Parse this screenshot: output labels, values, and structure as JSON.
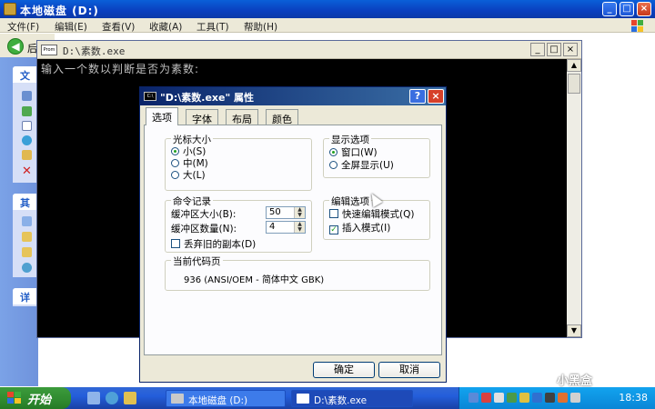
{
  "explorer": {
    "title": "本地磁盘 (D:)",
    "menu": [
      "文件(F)",
      "编辑(E)",
      "查看(V)",
      "收藏(A)",
      "工具(T)",
      "帮助(H)"
    ],
    "back_label": "后",
    "task_headers": [
      "文",
      "其",
      "详"
    ]
  },
  "console": {
    "title": "D:\\素数.exe",
    "icon_text": "Prom",
    "output": "输入一个数以判断是否为素数:"
  },
  "dialog": {
    "title": "\"D:\\素数.exe\" 属性",
    "icon_text": "C:\\",
    "tabs": [
      "选项",
      "字体",
      "布局",
      "颜色"
    ],
    "cursor_size": {
      "label": "光标大小",
      "options": [
        "小(S)",
        "中(M)",
        "大(L)"
      ],
      "selected": 0
    },
    "display_options": {
      "label": "显示选项",
      "options": [
        "窗口(W)",
        "全屏显示(U)"
      ],
      "selected": 0
    },
    "command_history": {
      "label": "命令记录",
      "buffer_size_label": "缓冲区大小(B):",
      "buffer_size_value": "50",
      "buffer_count_label": "缓冲区数量(N):",
      "buffer_count_value": "4",
      "discard_label": "丢弃旧的副本(D)",
      "discard_checked": false
    },
    "edit_options": {
      "label": "编辑选项",
      "quick_edit_label": "快速编辑模式(Q)",
      "quick_edit_checked": false,
      "insert_label": "插入模式(I)",
      "insert_checked": true
    },
    "codepage": {
      "label": "当前代码页",
      "value": "936   (ANSI/OEM - 简体中文 GBK)"
    },
    "ok_label": "确定",
    "cancel_label": "取消"
  },
  "taskbar": {
    "start_label": "开始",
    "items": [
      {
        "label": "本地磁盘 (D:)",
        "active": false
      },
      {
        "label": "D:\\素数.exe",
        "active": true
      }
    ],
    "clock": "18:38"
  },
  "watermark": "小黑盒"
}
